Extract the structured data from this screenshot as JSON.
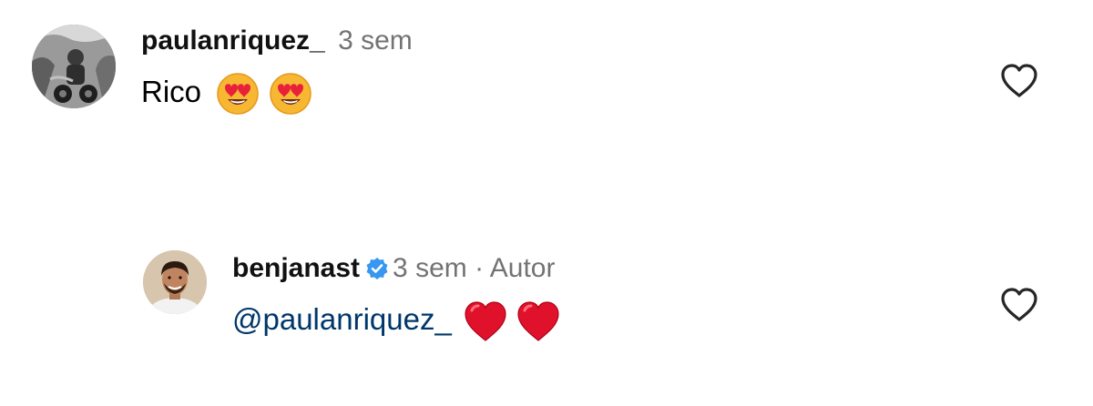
{
  "comments": [
    {
      "username": "paulanriquez_",
      "time": "3 sem",
      "text": "Rico",
      "emojis": [
        "heart-eyes-emoji",
        "heart-eyes-emoji"
      ],
      "like_icon": "heart-outline-icon"
    },
    {
      "username": "benjanast",
      "verified": true,
      "time": "3 sem",
      "separator": "·",
      "author_label": "Autor",
      "mention": "@paulanriquez_",
      "emojis": [
        "red-heart-emoji",
        "red-heart-emoji"
      ],
      "like_icon": "heart-outline-icon"
    }
  ],
  "colors": {
    "mention": "#00376b",
    "meta_gray": "#737373",
    "verified_blue": "#3897f0"
  }
}
